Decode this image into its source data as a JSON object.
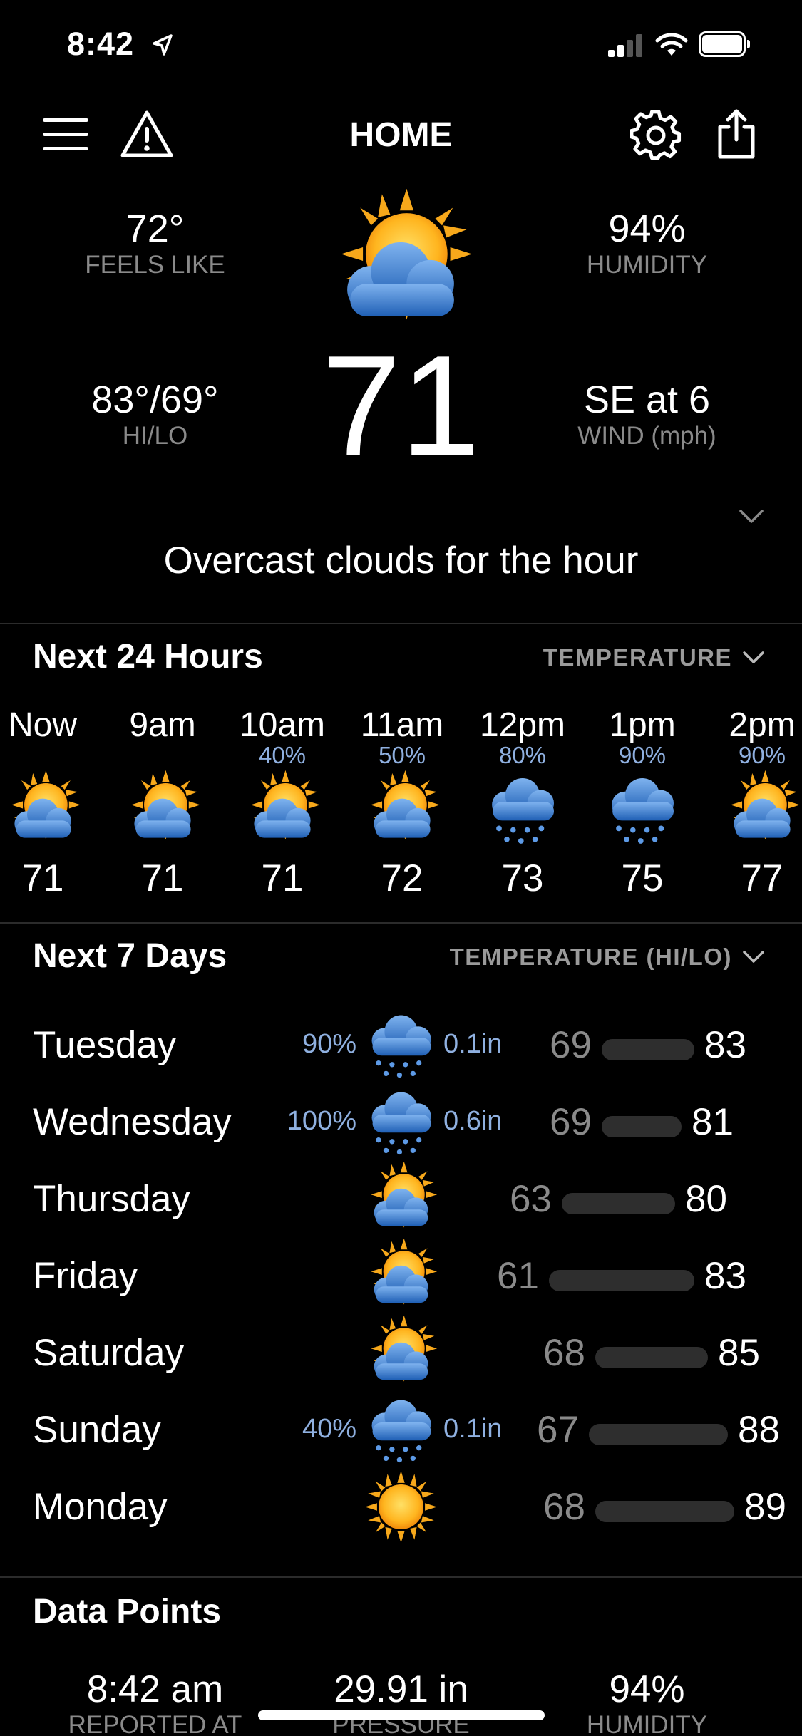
{
  "status_bar": {
    "time": "8:42"
  },
  "header": {
    "title": "HOME"
  },
  "current": {
    "feels_like_value": "72°",
    "feels_like_label": "FEELS LIKE",
    "humidity_value": "94%",
    "humidity_label": "HUMIDITY",
    "hilo_value": "83°/69°",
    "hilo_label": "HI/LO",
    "wind_value": "SE at 6",
    "wind_label": "WIND (mph)",
    "temperature": "71",
    "summary": "Overcast clouds for the hour",
    "icon": "partly-cloudy-icon"
  },
  "hourly": {
    "title": "Next 24 Hours",
    "dropdown": "TEMPERATURE",
    "items": [
      {
        "time": "Now",
        "pop": "",
        "icon": "partly-cloudy",
        "temp": "71"
      },
      {
        "time": "9am",
        "pop": "",
        "icon": "partly-cloudy",
        "temp": "71"
      },
      {
        "time": "10am",
        "pop": "40%",
        "icon": "partly-cloudy",
        "temp": "71"
      },
      {
        "time": "11am",
        "pop": "50%",
        "icon": "partly-cloudy",
        "temp": "72"
      },
      {
        "time": "12pm",
        "pop": "80%",
        "icon": "rain",
        "temp": "73"
      },
      {
        "time": "1pm",
        "pop": "90%",
        "icon": "rain",
        "temp": "75"
      },
      {
        "time": "2pm",
        "pop": "90%",
        "icon": "partly-cloudy",
        "temp": "77"
      }
    ]
  },
  "daily": {
    "title": "Next 7 Days",
    "dropdown": "TEMPERATURE (HI/LO)",
    "items": [
      {
        "day": "Tuesday",
        "pop": "90%",
        "icon": "rain",
        "precip": "0.1in",
        "lo": "69",
        "hi": "83"
      },
      {
        "day": "Wednesday",
        "pop": "100%",
        "icon": "rain",
        "precip": "0.6in",
        "lo": "69",
        "hi": "81"
      },
      {
        "day": "Thursday",
        "pop": "",
        "icon": "partly-cloudy",
        "precip": "",
        "lo": "63",
        "hi": "80"
      },
      {
        "day": "Friday",
        "pop": "",
        "icon": "partly-cloudy",
        "precip": "",
        "lo": "61",
        "hi": "83"
      },
      {
        "day": "Saturday",
        "pop": "",
        "icon": "partly-cloudy",
        "precip": "",
        "lo": "68",
        "hi": "85"
      },
      {
        "day": "Sunday",
        "pop": "40%",
        "icon": "rain",
        "precip": "0.1in",
        "lo": "67",
        "hi": "88"
      },
      {
        "day": "Monday",
        "pop": "",
        "icon": "sun",
        "precip": "",
        "lo": "68",
        "hi": "89"
      }
    ]
  },
  "data_points": {
    "title": "Data Points",
    "items": [
      {
        "value": "8:42 am",
        "label": "REPORTED AT"
      },
      {
        "value": "29.91 in",
        "label": "PRESSURE"
      },
      {
        "value": "94%",
        "label": "HUMIDITY"
      }
    ]
  },
  "colors": {
    "background": "#000000",
    "accent_blue": "#8fb0e0",
    "sun": "#f7a81b",
    "cloud": "#3d7fd0"
  }
}
